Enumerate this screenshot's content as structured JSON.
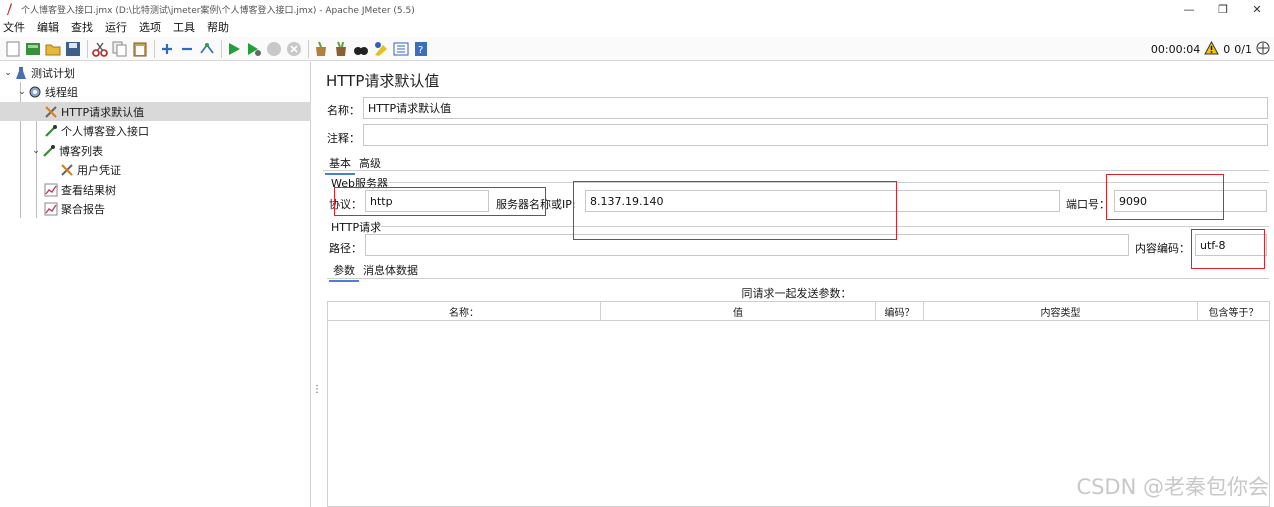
{
  "window": {
    "title": "个人博客登入接口.jmx (D:\\比特测试\\jmeter案例\\个人博客登入接口.jmx) - Apache JMeter (5.5)",
    "controls": [
      "—",
      "❐",
      "✕"
    ]
  },
  "menu": [
    "文件",
    "编辑",
    "查找",
    "运行",
    "选项",
    "工具",
    "帮助"
  ],
  "status": {
    "timer": "00:00:04",
    "warnings": "0",
    "threads": "0/1"
  },
  "tree": [
    {
      "label": "测试计划",
      "icon": "flask-icon"
    },
    {
      "label": "线程组",
      "icon": "gear-icon"
    },
    {
      "label": "HTTP请求默认值",
      "icon": "wrench-icon"
    },
    {
      "label": "个人博客登入接口",
      "icon": "pipette-icon"
    },
    {
      "label": "博客列表",
      "icon": "pipette-icon"
    },
    {
      "label": "用户凭证",
      "icon": "wrench-icon"
    },
    {
      "label": "查看结果树",
      "icon": "chart-icon"
    },
    {
      "label": "聚合报告",
      "icon": "chart-icon"
    }
  ],
  "panel": {
    "title": "HTTP请求默认值",
    "name_label": "名称：",
    "name_value": "HTTP请求默认值",
    "comment_label": "注释：",
    "comment_value": "",
    "tabs": [
      "基本",
      "高级"
    ],
    "web_server_group": "Web服务器",
    "protocol_label": "协议：",
    "protocol_value": "http",
    "server_label": "服务器名称或IP:",
    "server_value": "8.137.19.140",
    "port_label": "端口号：",
    "port_value": "9090",
    "http_request_group": "HTTP请求",
    "path_label": "路径：",
    "path_value": "",
    "encoding_label": "内容编码：",
    "encoding_value": "utf-8",
    "sub_tabs": [
      "参数",
      "消息体数据"
    ],
    "table_caption": "同请求一起发送参数：",
    "table_headers": [
      "名称：",
      "值",
      "编码？",
      "内容类型",
      "包含等于？"
    ]
  },
  "watermark": "CSDN @老秦包你会",
  "colors": {
    "highlight_box": "#e0202a",
    "tree_selected": "#d9d9d9"
  }
}
